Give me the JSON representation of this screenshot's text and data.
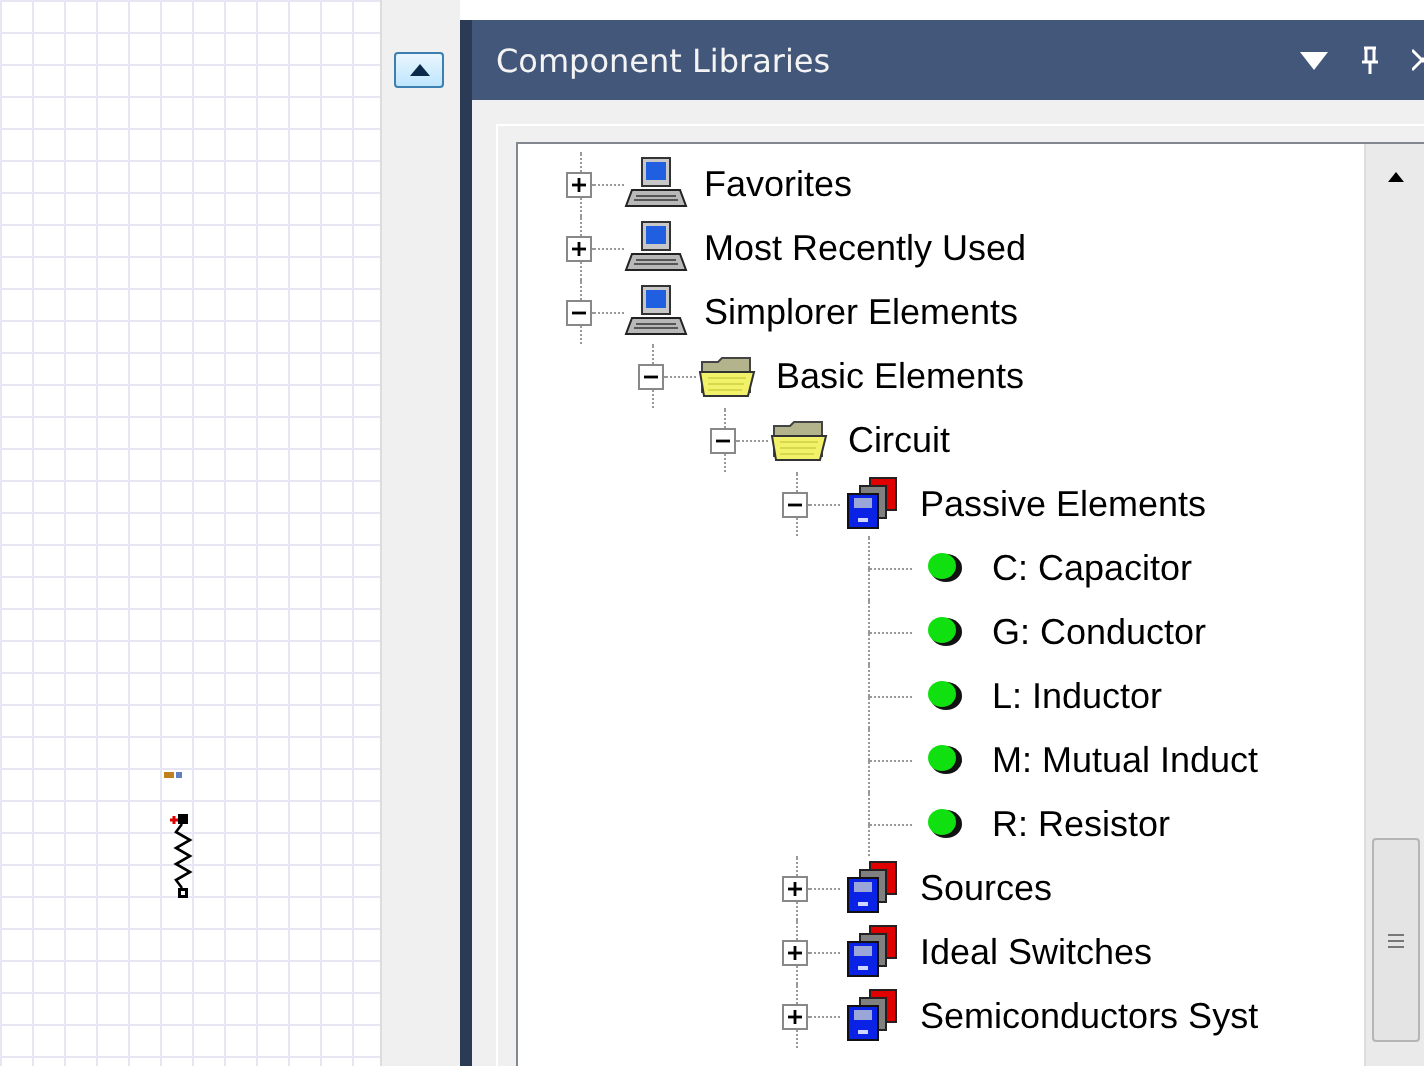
{
  "panel": {
    "title": "Component Libraries"
  },
  "tree": [
    {
      "label": "Favorites",
      "kind": "computer",
      "expanded": false
    },
    {
      "label": "Most Recently Used",
      "kind": "computer",
      "expanded": false
    },
    {
      "label": "Simplorer Elements",
      "kind": "computer",
      "expanded": true,
      "children": [
        {
          "label": "Basic Elements",
          "kind": "folder",
          "expanded": true,
          "children": [
            {
              "label": "Circuit",
              "kind": "folder",
              "expanded": true,
              "children": [
                {
                  "label": "Passive Elements",
                  "kind": "library",
                  "expanded": true,
                  "children": [
                    {
                      "label": "C: Capacitor",
                      "kind": "element"
                    },
                    {
                      "label": "G: Conductor",
                      "kind": "element"
                    },
                    {
                      "label": "L: Inductor",
                      "kind": "element"
                    },
                    {
                      "label": "M: Mutual Induct",
                      "kind": "element"
                    },
                    {
                      "label": "R: Resistor",
                      "kind": "element"
                    }
                  ]
                },
                {
                  "label": "Sources",
                  "kind": "library",
                  "expanded": false
                },
                {
                  "label": "Ideal Switches",
                  "kind": "library",
                  "expanded": false
                },
                {
                  "label": "Semiconductors Syst",
                  "kind": "library",
                  "expanded": false
                }
              ]
            }
          ]
        }
      ]
    }
  ]
}
